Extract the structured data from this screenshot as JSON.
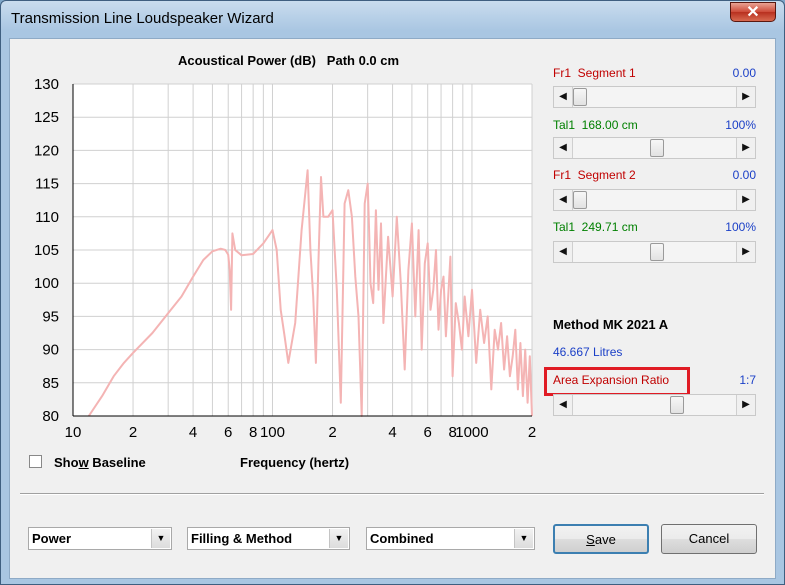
{
  "window": {
    "title": "Transmission Line Loudspeaker Wizard",
    "close_glyph": "✕"
  },
  "chart": {
    "title": "Acoustical Power (dB)   Path 0.0 cm",
    "xlabel": "Frequency (hertz)"
  },
  "chart_data": {
    "type": "line",
    "title": "Acoustical Power (dB)   Path 0.0 cm",
    "xlabel": "Frequency (hertz)",
    "ylabel": "",
    "x_scale": "log",
    "xlim": [
      10,
      2000
    ],
    "ylim": [
      80,
      130
    ],
    "yticks": [
      "130",
      "125",
      "120",
      "115",
      "110",
      "105",
      "100",
      "95",
      "90",
      "85",
      "80"
    ],
    "xticks": [
      "10",
      "2",
      "4",
      "6",
      "8",
      "100",
      "2",
      "4",
      "6",
      "8",
      "1000",
      "2"
    ],
    "grid": true,
    "line_color": "#f4b4b4",
    "series": [
      {
        "x": [
          12,
          14,
          16,
          18,
          20,
          25,
          30,
          35,
          40,
          45,
          50,
          55,
          58,
          60,
          61,
          62,
          63,
          65,
          70,
          80,
          90,
          100,
          105,
          110,
          115,
          120,
          130,
          140,
          150,
          155,
          160,
          165,
          170,
          175,
          180,
          190,
          200,
          210,
          220,
          230,
          240,
          250,
          260,
          270,
          280,
          290,
          300,
          305,
          310,
          320,
          330,
          340,
          350,
          360,
          380,
          400,
          420,
          440,
          460,
          480,
          500,
          520,
          540,
          560,
          580,
          600,
          620,
          640,
          660,
          680,
          700,
          720,
          740,
          760,
          780,
          800,
          830,
          860,
          890,
          920,
          960,
          1000,
          1050,
          1100,
          1150,
          1200,
          1250,
          1300,
          1350,
          1400,
          1450,
          1500,
          1550,
          1600,
          1650,
          1700,
          1750,
          1800,
          1850,
          1900,
          1950,
          2000
        ],
        "y": [
          80,
          83,
          86,
          88,
          89.5,
          92.5,
          95.5,
          98,
          101,
          103.5,
          104.8,
          105.2,
          105,
          104.3,
          102,
          96,
          107.5,
          105,
          104.2,
          104.4,
          106,
          108,
          105,
          96,
          92,
          88,
          94,
          108,
          117,
          105,
          98,
          88,
          103,
          116,
          110,
          110,
          111,
          99,
          82,
          112,
          114,
          110,
          101,
          95,
          80,
          112,
          115,
          108,
          100,
          97,
          111,
          99,
          109,
          94,
          107,
          98,
          110,
          100,
          87,
          102,
          109,
          95,
          108,
          90,
          103,
          106,
          96,
          99,
          105,
          93,
          99,
          101,
          92,
          98,
          104,
          86,
          97,
          94,
          90,
          98,
          92,
          99,
          88,
          96,
          91,
          95,
          84,
          93,
          90,
          94,
          87,
          92,
          86,
          89,
          93,
          84,
          91,
          83,
          90,
          82,
          89,
          80
        ]
      }
    ]
  },
  "controls": {
    "fr1_seg1_label": "Fr1  Segment 1",
    "fr1_seg1_value": "0.00",
    "fr1_seg1_level": 0,
    "tal1_a_label": "Tal1  168.00 cm",
    "tal1_a_value": "100%",
    "tal1_a_level": 0.52,
    "fr1_seg2_label": "Fr1  Segment 2",
    "fr1_seg2_value": "0.00",
    "fr1_seg2_level": 0,
    "tal1_b_label": "Tal1  249.71 cm",
    "tal1_b_value": "100%",
    "tal1_b_level": 0.52,
    "method": "Method MK 2021 A",
    "litres": "46.667 Litres",
    "area_label": "Area Expansion Ratio",
    "area_value": "1:7",
    "area_level": 0.65
  },
  "baseline": {
    "label_pre": "Sho",
    "label_u": "w",
    "label_post": " Baseline",
    "checked": false
  },
  "bottom": {
    "combo1": "Power",
    "combo2": "Filling & Method",
    "combo3": "Combined",
    "save_u": "S",
    "save_rest": "ave",
    "cancel": "Cancel"
  },
  "colors": {
    "red_label": "#c00000",
    "green_label": "#008000",
    "blue_value": "#1a3fc7",
    "highlight": "#e01b24"
  }
}
